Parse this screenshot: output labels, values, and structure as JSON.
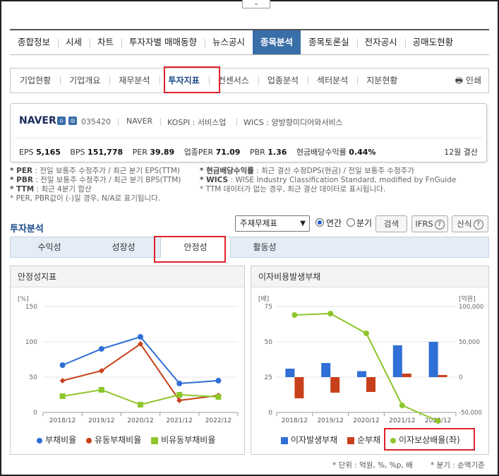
{
  "top_toggle": "⌄",
  "main_nav": [
    "종합정보",
    "시세",
    "차트",
    "투자자별 매매동향",
    "뉴스공시",
    "종목분석",
    "종목토론실",
    "전자공시",
    "공매도현황"
  ],
  "main_nav_active": "종목분석",
  "sub_nav": [
    "기업현황",
    "기업개요",
    "재무분석",
    "투자지표",
    "컨센서스",
    "업종분석",
    "섹터분석",
    "지분현황"
  ],
  "sub_nav_active": "투자지표",
  "print_label": "인쇄",
  "company": {
    "name": "NAVER",
    "code": "035420",
    "market_name": "NAVER",
    "kospi": "KOSPI : 서비스업",
    "wics": "WICS : 양방향미디어와서비스",
    "stats": [
      {
        "label": "EPS",
        "value": "5,165"
      },
      {
        "label": "BPS",
        "value": "151,778"
      },
      {
        "label": "PER",
        "value": "39.89"
      },
      {
        "label": "업종PER",
        "value": "71.09"
      },
      {
        "label": "PBR",
        "value": "1.36"
      },
      {
        "label": "현금배당수익률",
        "value": "0.44%"
      }
    ],
    "settlement": "12월 결산"
  },
  "notes_left": [
    {
      "key": "* PER",
      "text": " : 전일 보통주 수정주가 / 최근 분기 EPS(TTM)"
    },
    {
      "key": "* PBR",
      "text": " : 전일 보통주 수정주가 / 최근 분기 BPS(TTM)"
    },
    {
      "key": "* TTM",
      "text": " : 최근 4분기 합산"
    },
    {
      "key": "",
      "text": "* PER, PBR값이 (-)일 경우, N/A로 표기됩니다."
    }
  ],
  "notes_right": [
    {
      "key": "* 현금배당수익률",
      "text": " : 최근 결산 수정DPS(현금) / 전일 보통주 수정주가"
    },
    {
      "key": "* WICS",
      "text": " : WISE Industry Classification Standard, modified by FnGuide"
    },
    {
      "key": "",
      "text": "* TTM 데이터가 없는 경우, 최근 결산 데이터로 표시됩니다."
    }
  ],
  "analysis": {
    "title": "투자분석",
    "select_value": "주재무제표",
    "radio_annual": "연간",
    "radio_quarter": "분기",
    "search_btn": "검색",
    "ifrs_btn": "IFRS",
    "formula_btn": "산식",
    "tabs": [
      "수익성",
      "성장성",
      "안정성",
      "활동성"
    ],
    "active_tab": "안정성"
  },
  "panel_left": {
    "title": "안정성지표"
  },
  "panel_right": {
    "title": "이자비용발생부채"
  },
  "chart_data": [
    {
      "type": "line",
      "title": "안정성지표",
      "ylabel": "[%]",
      "x": [
        "2018/12",
        "2019/12",
        "2020/12",
        "2021/12",
        "2022/12"
      ],
      "ylim": [
        0,
        150
      ],
      "yticks": [
        0,
        50,
        100,
        150
      ],
      "series": [
        {
          "name": "부채비율",
          "values": [
            67,
            90,
            107,
            41,
            45
          ],
          "color": "#2f6fd6",
          "marker": "circle"
        },
        {
          "name": "유동부채비율",
          "values": [
            45,
            59,
            97,
            17,
            24
          ],
          "color": "#c8401b",
          "marker": "diamond"
        },
        {
          "name": "비유동부채비율",
          "values": [
            23,
            32,
            11,
            25,
            22
          ],
          "color": "#8dc62a",
          "marker": "square"
        }
      ]
    },
    {
      "type": "bar",
      "title": "이자비용발생부채",
      "ylabel_left": "[배]",
      "ylabel_right": "[억원]",
      "x": [
        "2018/12",
        "2019/12",
        "2020/12",
        "2021/12",
        "2022/12"
      ],
      "ylim_left": [
        0,
        75
      ],
      "yticks_left": [
        0,
        25,
        50,
        75
      ],
      "ylim_right": [
        -50000,
        100000
      ],
      "yticks_right": [
        "-50,000",
        "0",
        "50,000",
        "100,000"
      ],
      "series": [
        {
          "name": "이자발생부채",
          "axis": "right",
          "kind": "bar",
          "values": [
            12000,
            20000,
            8500,
            45000,
            50000
          ],
          "color": "#2f6fd6"
        },
        {
          "name": "순부채",
          "axis": "right",
          "kind": "bar",
          "values": [
            -30000,
            -22000,
            -21000,
            5000,
            3000
          ],
          "color": "#c8401b"
        },
        {
          "name": "이자보상배율(좌)",
          "axis": "left",
          "kind": "line",
          "values": [
            69,
            70,
            56,
            5,
            -6
          ],
          "color": "#8dc62a"
        }
      ]
    }
  ],
  "footnote_left": "* 단위 : 억원, %, %p, 배",
  "footnote_right": "* 분기 : 순액기준"
}
